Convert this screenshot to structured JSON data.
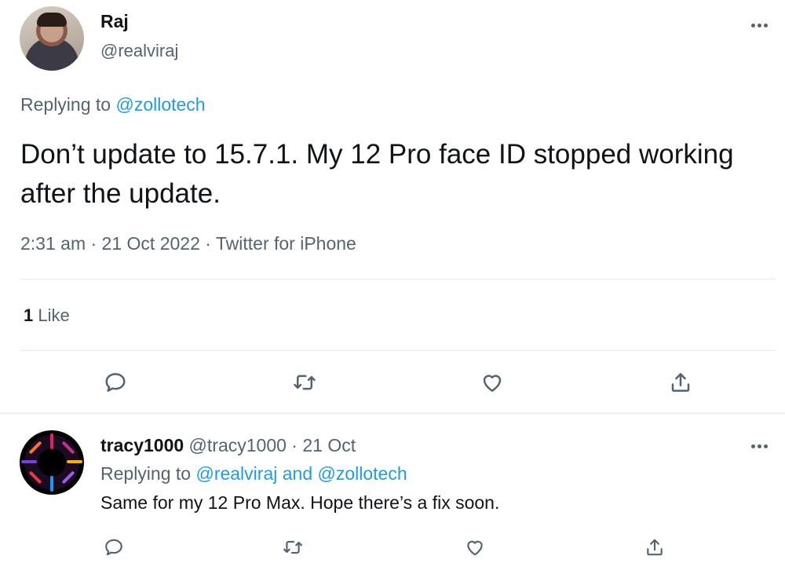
{
  "main_tweet": {
    "author_name": "Raj",
    "author_handle": "@realviraj",
    "replying_prefix": "Replying to ",
    "replying_handle": "@zollotech",
    "text": "Don’t update to 15.7.1. My 12 Pro face ID stopped working after the update.",
    "meta": "2:31 am · 21 Oct 2022 · Twitter for iPhone",
    "likes_count": "1",
    "likes_label": " Like"
  },
  "reply_tweet": {
    "author_name": "tracy1000",
    "author_handle_date": " @tracy1000 · 21 Oct",
    "replying_prefix": "Replying to ",
    "replying_handle_1": "@realviraj",
    "replying_and": " and ",
    "replying_handle_2": "@zollotech",
    "text": "Same for my 12 Pro Max. Hope there’s a fix soon."
  },
  "icons": [
    "reply-icon",
    "retweet-icon",
    "like-icon",
    "share-icon",
    "more-icon"
  ],
  "colors": {
    "link": "#1d9bf0",
    "secondary_text": "#536471",
    "primary_text": "#0f1419"
  }
}
